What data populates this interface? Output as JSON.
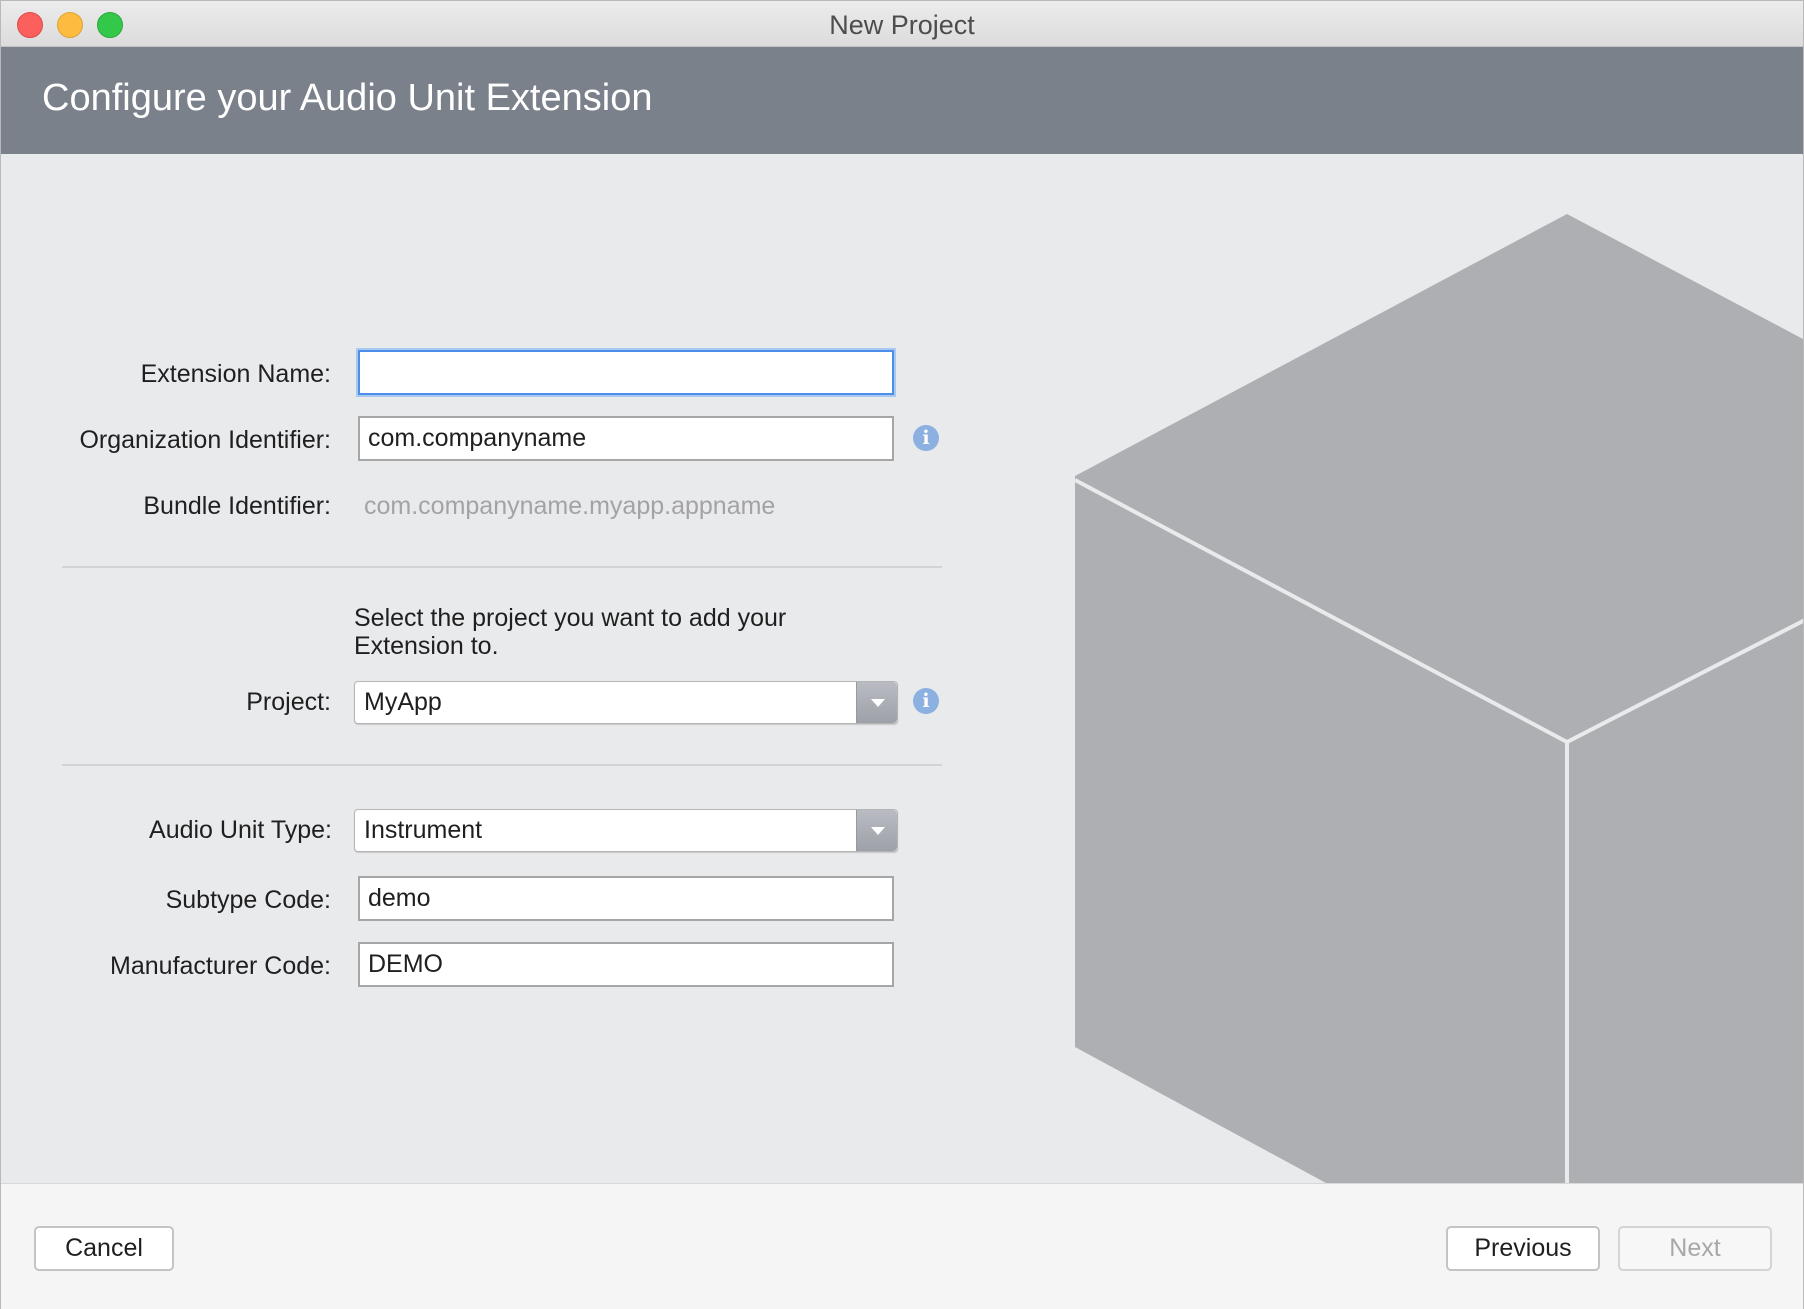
{
  "window": {
    "title": "New Project",
    "traffic_lights": [
      "close",
      "minimize",
      "maximize"
    ]
  },
  "header": {
    "title": "Configure your Audio Unit Extension"
  },
  "form": {
    "extension_name": {
      "label": "Extension Name:",
      "value": ""
    },
    "organization_identifier": {
      "label": "Organization Identifier:",
      "value": "com.companyname"
    },
    "bundle_identifier": {
      "label": "Bundle Identifier:",
      "value": "com.companyname.myapp.appname"
    },
    "project_hint": "Select the project you want to add your Extension to.",
    "project": {
      "label": "Project:",
      "value": "MyApp"
    },
    "audio_unit_type": {
      "label": "Audio Unit Type:",
      "value": "Instrument"
    },
    "subtype_code": {
      "label": "Subtype Code:",
      "value": "demo"
    },
    "manufacturer_code": {
      "label": "Manufacturer Code:",
      "value": "DEMO"
    },
    "info_icon_glyph": "i"
  },
  "footer": {
    "cancel_label": "Cancel",
    "previous_label": "Previous",
    "next_label": "Next"
  },
  "colors": {
    "banner": "#7a818b",
    "content_bg": "#e9eaec",
    "cube_fill": "#aeafb3",
    "focus_ring": "#4d8ee8",
    "info_icon": "#8cb0e0"
  }
}
